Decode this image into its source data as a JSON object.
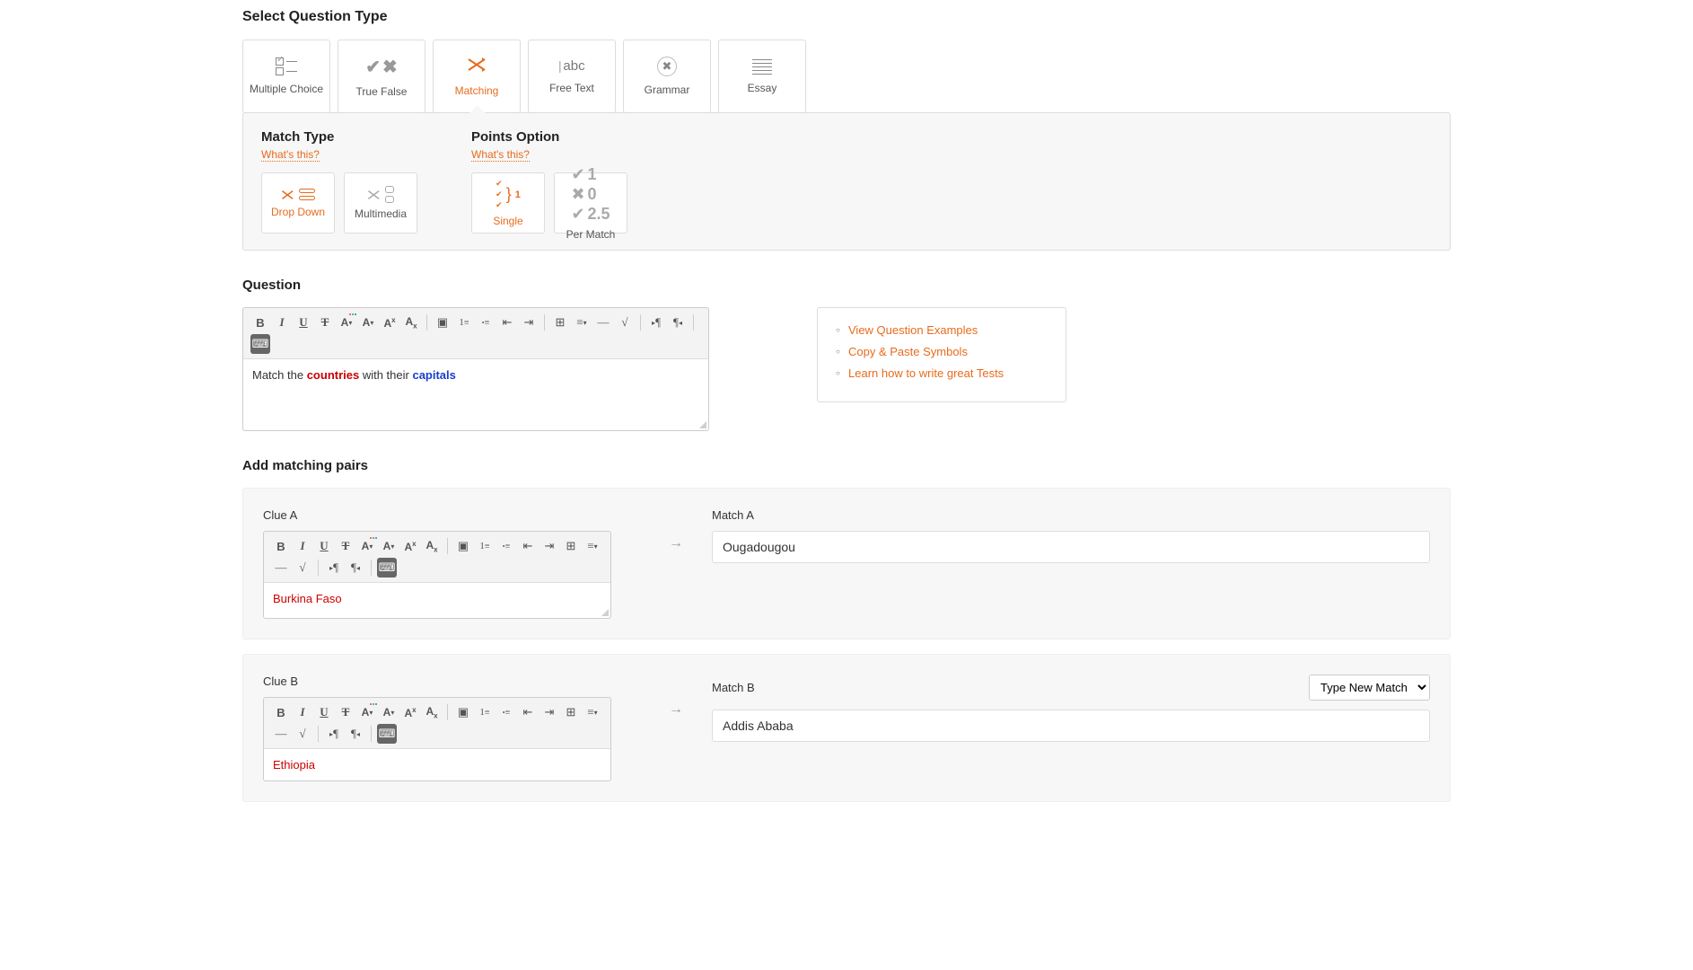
{
  "select_question_type": {
    "title": "Select Question Type",
    "types": {
      "multiple_choice": "Multiple Choice",
      "true_false": "True False",
      "matching": "Matching",
      "free_text": "Free Text",
      "grammar": "Grammar",
      "essay": "Essay"
    }
  },
  "match_type": {
    "title": "Match Type",
    "whats_this": "What's this?",
    "options": {
      "drop_down": "Drop Down",
      "multimedia": "Multimedia"
    }
  },
  "points_option": {
    "title": "Points Option",
    "whats_this": "What's this?",
    "options": {
      "single": "Single",
      "per_match": "Per Match",
      "per_match_values": {
        "v1": "1",
        "v2": "0",
        "v3": "2.5"
      }
    }
  },
  "question": {
    "title": "Question",
    "text_prefix": "Match the ",
    "text_word1": "countries",
    "text_mid": " with their ",
    "text_word2": "capitals"
  },
  "help_links": {
    "examples": "View Question Examples",
    "symbols": "Copy & Paste Symbols",
    "learn": "Learn how to write great Tests"
  },
  "pairs": {
    "title": "Add matching pairs",
    "pair_a": {
      "clue_label": "Clue A",
      "clue_value": "Burkina Faso",
      "match_label": "Match A",
      "match_value": "Ougadougou"
    },
    "pair_b": {
      "clue_label": "Clue B",
      "clue_value": "Ethiopia",
      "match_label": "Match B",
      "match_value": "Addis Ababa",
      "new_match_select": "Type New Match"
    }
  },
  "toolbar": {
    "bold": "B",
    "italic": "I",
    "underline": "U",
    "strike": "T",
    "textcolor": "A",
    "bgcolor": "A",
    "sup": "x",
    "sub": "x",
    "image": "▣",
    "ol": "≡",
    "ul": "≡",
    "outdent": "⇤",
    "indent": "⇥",
    "table": "⊞",
    "align": "≡",
    "hr": "—",
    "formula": "√",
    "ltr": "¶",
    "rtl": "¶",
    "keyboard": "⌨"
  },
  "arrow": "→"
}
